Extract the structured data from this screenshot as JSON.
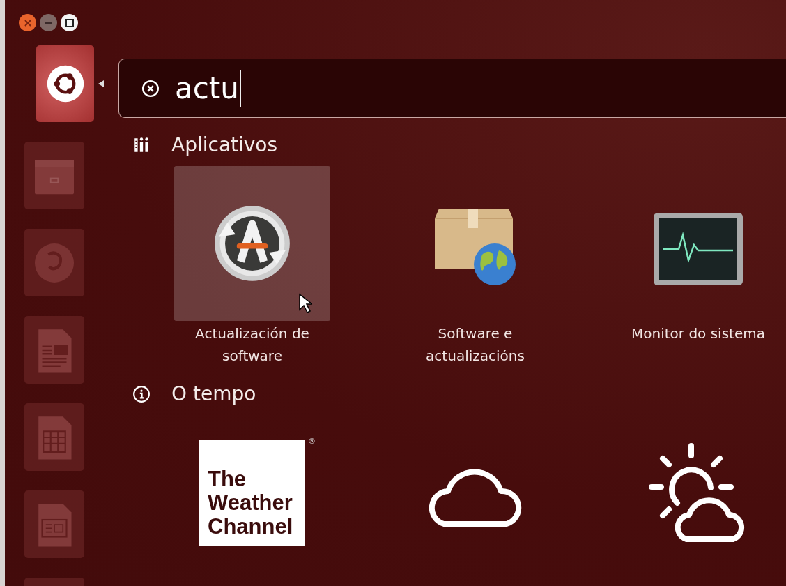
{
  "window_controls": [
    {
      "kind": "close"
    },
    {
      "kind": "minimize"
    },
    {
      "kind": "maximize"
    }
  ],
  "launcher": [
    {
      "kind": "dash",
      "selected": true
    },
    {
      "kind": "files",
      "selected": false
    },
    {
      "kind": "browser",
      "selected": false
    },
    {
      "kind": "writer",
      "selected": false
    },
    {
      "kind": "calc",
      "selected": false
    },
    {
      "kind": "impress",
      "selected": false
    },
    {
      "kind": "blank",
      "selected": false
    }
  ],
  "search": {
    "value": "actu"
  },
  "categories": [
    {
      "kind": "apps",
      "title": "Aplicativos",
      "results": [
        {
          "kind": "updater",
          "label": [
            "Actualización de",
            "software"
          ],
          "selected": true
        },
        {
          "kind": "sources",
          "label": [
            "Software e",
            "actualizacións"
          ],
          "selected": false
        },
        {
          "kind": "monitor",
          "label": [
            "Monitor do sistema"
          ],
          "selected": false
        }
      ]
    },
    {
      "kind": "info",
      "title": "O tempo",
      "results": [
        {
          "kind": "weather-channel",
          "logo": {
            "lines": [
              "The",
              "Weather",
              "Channel"
            ],
            "mark": "®"
          },
          "selected": false
        },
        {
          "kind": "cloud",
          "selected": false
        },
        {
          "kind": "sun-cloud",
          "selected": false
        }
      ]
    }
  ]
}
